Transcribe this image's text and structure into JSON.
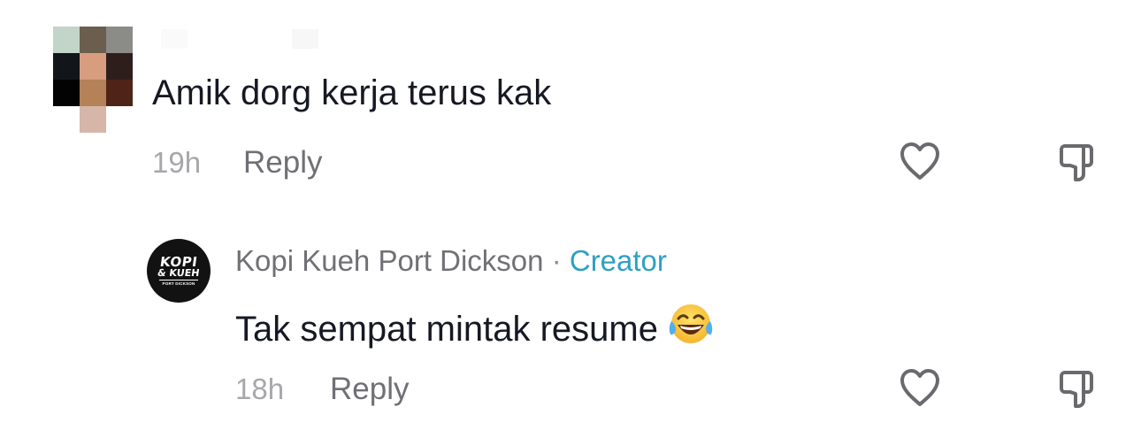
{
  "comments": [
    {
      "text": "Amik dorg kerja terus kak",
      "time": "19h",
      "reply_label": "Reply"
    }
  ],
  "reply": {
    "author": "Kopi Kueh Port Dickson",
    "separator": "·",
    "badge": "Creator",
    "text": "Tak sempat mintak resume",
    "emoji": "face-with-tears-of-joy-icon",
    "time": "18h",
    "reply_label": "Reply",
    "avatar_logo": {
      "line1": "KOPI",
      "line2": "& KUEH",
      "line3": "PORT DICKSON"
    }
  },
  "colors": {
    "text": "#161823",
    "meta": "#a7a7ab",
    "reply_action": "#6f6f75",
    "creator_badge": "#2ea0c1",
    "icon": "#6a6a6e"
  },
  "icons": [
    "heart-icon",
    "dislike-icon"
  ]
}
